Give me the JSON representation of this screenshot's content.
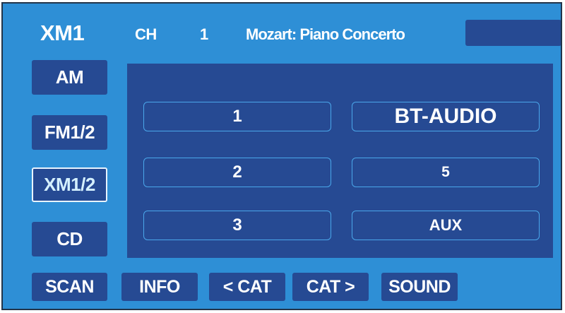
{
  "header": {
    "band": "XM1",
    "ch_label": "CH",
    "ch_number": "1",
    "song_title": "Mozart: Piano Concerto"
  },
  "source_buttons": [
    {
      "label": "AM"
    },
    {
      "label": "FM1/2"
    },
    {
      "label": "XM1/2",
      "selected": true
    },
    {
      "label": "CD"
    }
  ],
  "presets": {
    "left": [
      "1",
      "2",
      "3"
    ],
    "right": [
      "BT-AUDIO",
      "5",
      "AUX"
    ]
  },
  "bottom_buttons": [
    "SCAN",
    "INFO",
    "< CAT",
    "CAT >",
    "SOUND"
  ],
  "colors": {
    "background": "#2e8fd6",
    "panel": "#264a93",
    "button": "#264a93",
    "text": "#ffffff",
    "preset_border": "#4aa7ea",
    "selected_border": "#e8f4ff"
  }
}
